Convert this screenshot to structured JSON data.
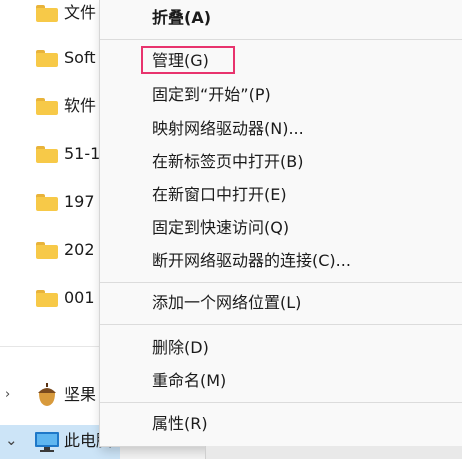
{
  "nav": {
    "folders": [
      {
        "label": "文件",
        "icon": "folder-icon"
      },
      {
        "label": "Soft",
        "icon": "folder-icon"
      },
      {
        "label": "软件",
        "icon": "folder-icon"
      },
      {
        "label": "51-1",
        "icon": "folder-icon"
      },
      {
        "label": "197",
        "icon": "folder-icon"
      },
      {
        "label": "202",
        "icon": "folder-icon"
      },
      {
        "label": "001",
        "icon": "folder-icon"
      }
    ],
    "nutstore": {
      "label": "坚果",
      "icon": "acorn-icon",
      "chevron": "›"
    },
    "this_pc": {
      "label": "此电脑",
      "icon": "computer-icon",
      "chevron": "⌄"
    }
  },
  "context_menu": {
    "items": {
      "collapse": "折叠(A)",
      "manage": "管理(G)",
      "pin_start": "固定到“开始”(P)",
      "map_drive": "映射网络驱动器(N)...",
      "open_new_tab": "在新标签页中打开(B)",
      "open_new_window": "在新窗口中打开(E)",
      "pin_quick_access": "固定到快速访问(Q)",
      "disconnect_drive": "断开网络驱动器的连接(C)...",
      "add_network_location": "添加一个网络位置(L)",
      "delete": "删除(D)",
      "rename": "重命名(M)",
      "properties": "属性(R)"
    },
    "highlight_color": "#e8336d"
  },
  "colors": {
    "folder": "#f7c948",
    "selected_row": "#cce4f7"
  }
}
